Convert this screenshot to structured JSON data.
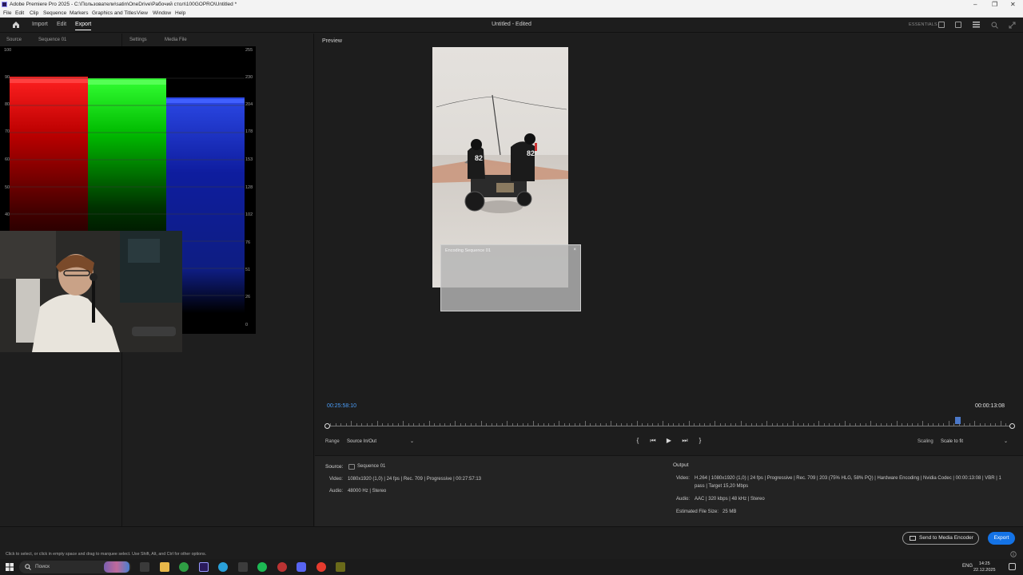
{
  "window": {
    "title": "Adobe Premiere Pro 2025 - C:\\Пользователи\\satin\\OneDrive\\Рабочий стол\\100GOPRO\\Untitled *",
    "controls": [
      "–",
      "❐",
      "✕"
    ]
  },
  "menu": [
    "File",
    "Edit",
    "Clip",
    "Sequence",
    "Markers",
    "Graphics and Titles",
    "View",
    "Window",
    "Help"
  ],
  "header": {
    "tabs": [
      {
        "label": "Import",
        "active": false
      },
      {
        "label": "Edit",
        "active": false
      },
      {
        "label": "Export",
        "active": true
      }
    ],
    "document_title": "Untitled - Edited",
    "workspace_label": "ESSENTIALS"
  },
  "source_panel": {
    "label": "Source",
    "sequence": "Sequence 01"
  },
  "settings_panel": {
    "label": "Settings",
    "item": "Media File"
  },
  "scope": {
    "left_axis": [
      "100",
      "90",
      "80",
      "70",
      "60",
      "50",
      "40"
    ],
    "right_axis": [
      "255",
      "230",
      "204",
      "178",
      "153",
      "128",
      "102",
      "76",
      "51",
      "26",
      "0"
    ],
    "channel_colors": [
      "#ff2020",
      "#22ff22",
      "#2040ff"
    ]
  },
  "preview": {
    "label": "Preview",
    "encoding_dialog_title": "Encoding Sequence 01",
    "rider_number": "82"
  },
  "timeline": {
    "timecode_in": "00:25:58:10",
    "timecode_duration": "00:00:13:08",
    "playhead_fraction": 0.92
  },
  "controls": {
    "range_label": "Range",
    "range_value": "Source In/Out",
    "scaling_label": "Scaling",
    "scaling_value": "Scale to fit",
    "buttons": [
      "{",
      "⏮",
      "▶",
      "⏭",
      "}"
    ]
  },
  "summary": {
    "source_label": "Source:",
    "source_name": "Sequence 01",
    "source_video_label": "Video:",
    "source_video": "1080x1920 (1,0) | 24 fps | Rec. 709 | Progressive | 00:27:57:13",
    "source_audio_label": "Audio:",
    "source_audio": "48000 Hz | Stereo",
    "output_label": "Output",
    "output_video_label": "Video:",
    "output_video_1": "H.264 | 1080x1920 (1,0) | 24 fps | Progressive | Rec. 709 | 203 (75% HLG, 58% PQ) | Hardware Encoding | Nvidia Codec | 00:00:13:08 | VBR | 1",
    "output_video_2": "pass | Target 15,20 Mbps",
    "output_audio_label": "Audio:",
    "output_audio": "AAC | 320 kbps | 48 kHz | Stereo",
    "file_size_label": "Estimated File Size:",
    "file_size": "25 MB"
  },
  "actions": {
    "send_label": "Send to Media Encoder",
    "export_label": "Export"
  },
  "status_text": "Click to select, or click in empty space and drag to marquee select. Use Shift, Alt, and Ctrl for other options.",
  "taskbar": {
    "search_placeholder": "Поиск",
    "lang": "ENG",
    "time": "14:25",
    "date": "22.12.2025"
  }
}
